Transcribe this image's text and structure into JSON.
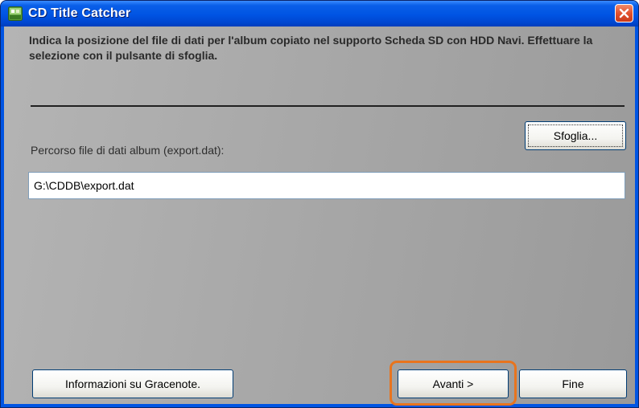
{
  "window": {
    "title": "CD Title Catcher"
  },
  "instruction": "Indica la posizione del file di dati per l'album copiato nel supporto Scheda SD con HDD Navi. Effettuare la selezione con il pulsante di sfoglia.",
  "path_field": {
    "label": "Percorso file di dati album (export.dat):",
    "value": "G:\\CDDB\\export.dat"
  },
  "buttons": {
    "browse": "Sfoglia...",
    "info": "Informazioni su Gracenote.",
    "next": "Avanti >",
    "finish": "Fine"
  },
  "icons": {
    "app": "app-icon",
    "close": "close-icon"
  },
  "colors": {
    "titlebar": "#0054e3",
    "highlight": "#e8741e",
    "close": "#e2512d"
  }
}
